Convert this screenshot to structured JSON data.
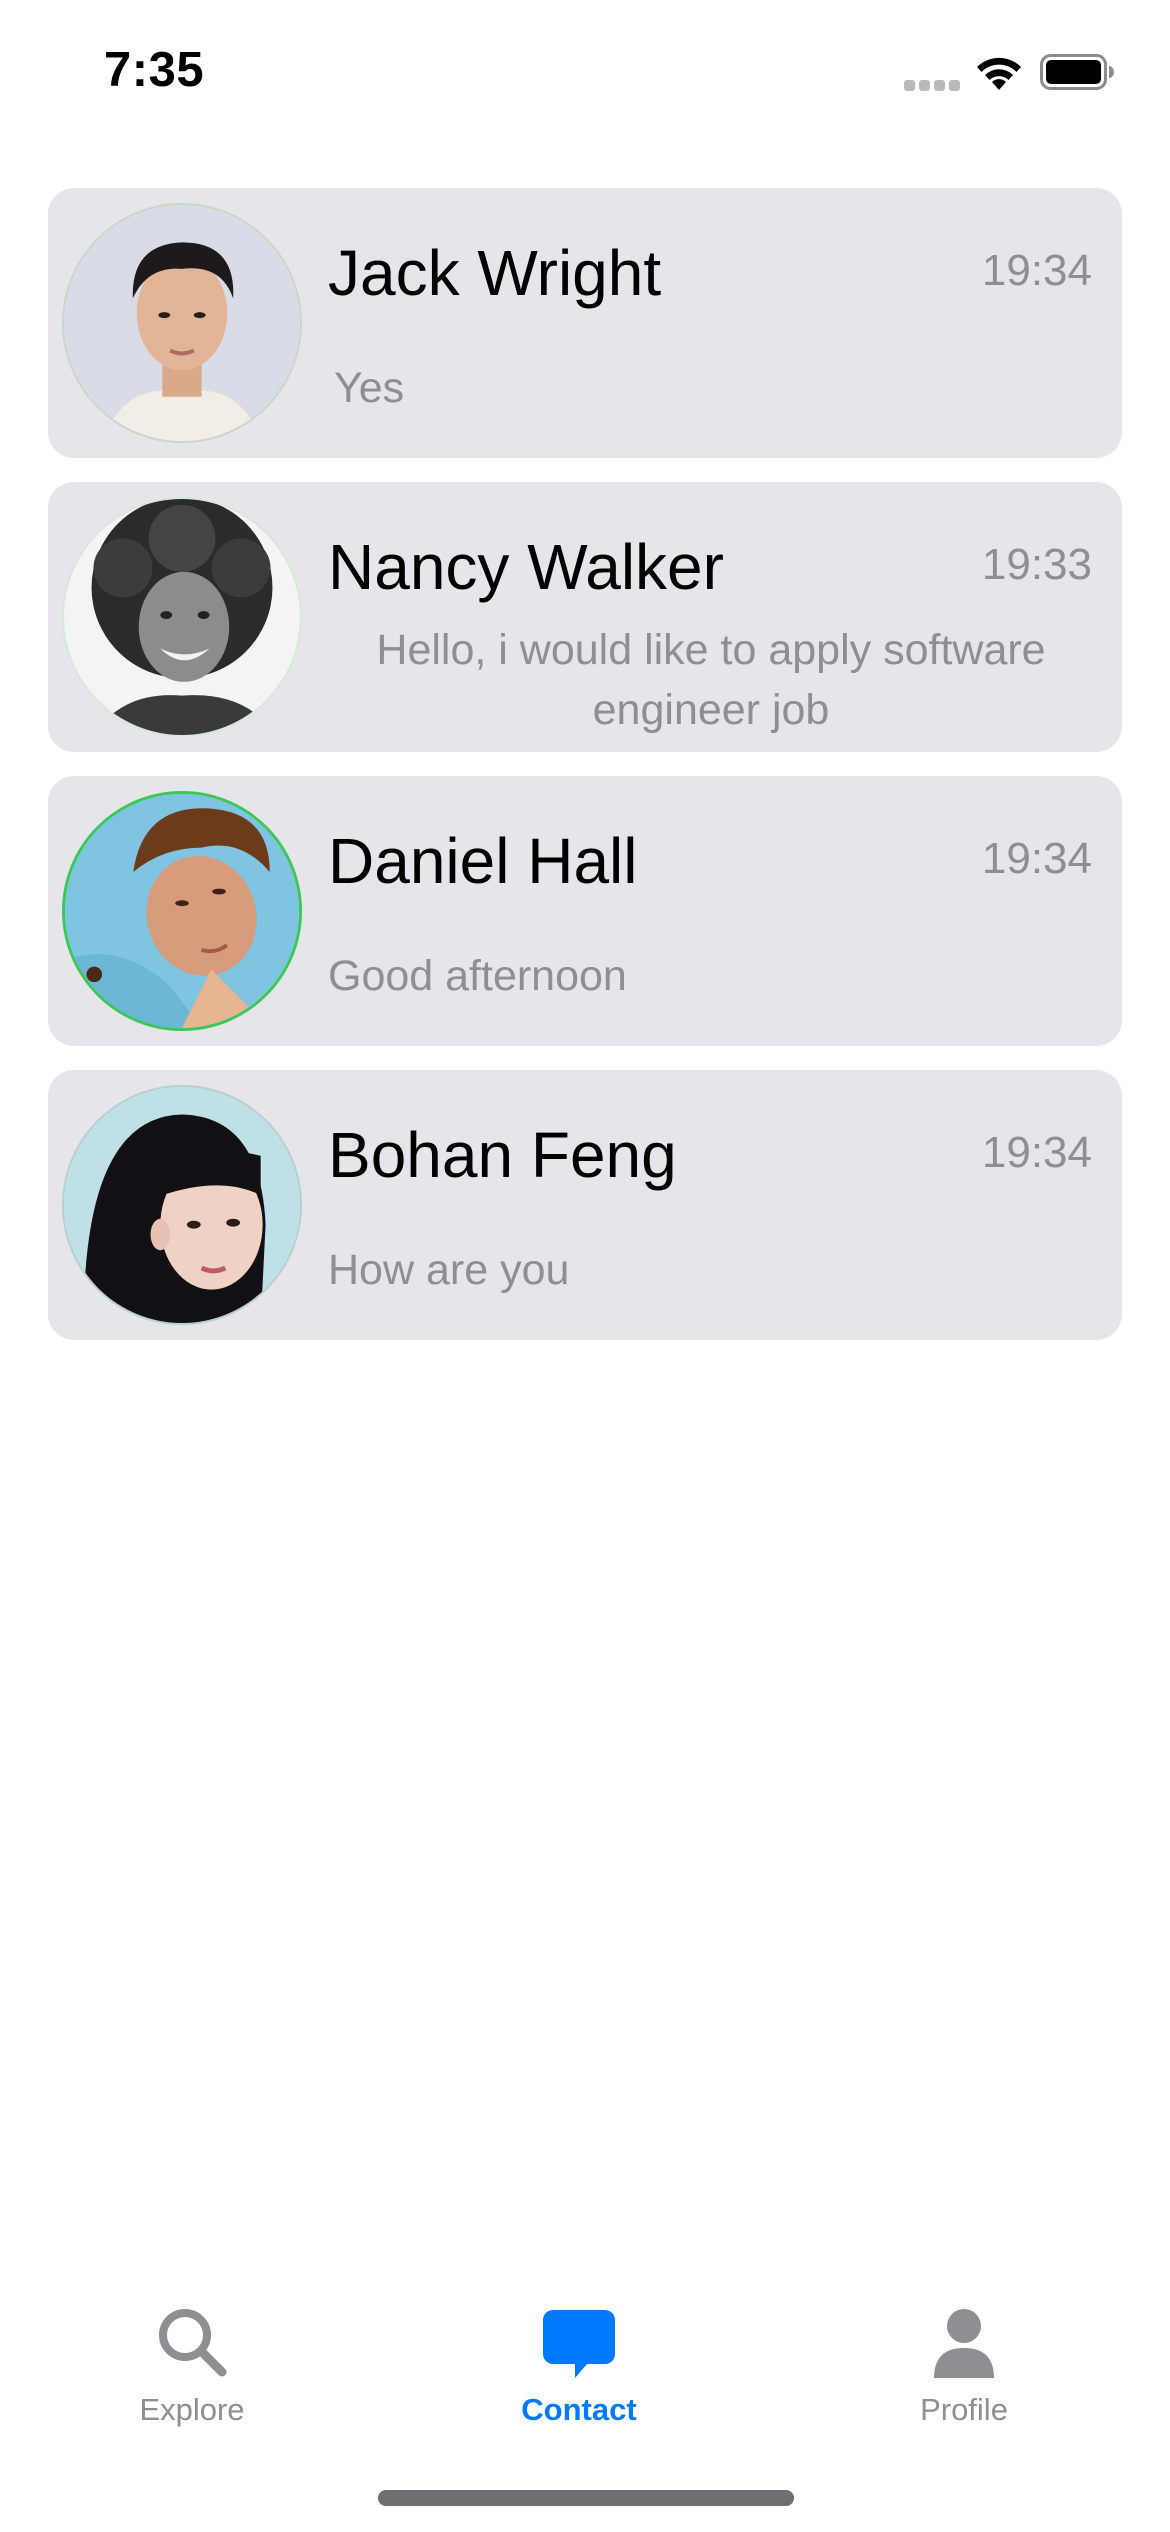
{
  "status_bar": {
    "time": "7:35"
  },
  "contacts": [
    {
      "name": "Jack Wright",
      "time": "19:34",
      "message": "Yes",
      "avatar_icon": "person-photo"
    },
    {
      "name": "Nancy Walker",
      "time": "19:33",
      "message": "Hello, i would like to apply software engineer job",
      "avatar_icon": "person-photo"
    },
    {
      "name": "Daniel Hall",
      "time": "19:34",
      "message": "Good afternoon",
      "avatar_icon": "person-photo"
    },
    {
      "name": "Bohan Feng",
      "time": "19:34",
      "message": "How are you",
      "avatar_icon": "person-photo"
    }
  ],
  "tab_bar": {
    "tabs": [
      {
        "label": "Explore",
        "icon": "magnifying-glass-icon",
        "active": false
      },
      {
        "label": "Contact",
        "icon": "chat-bubble-icon",
        "active": true
      },
      {
        "label": "Profile",
        "icon": "person-icon",
        "active": false
      }
    ]
  },
  "colors": {
    "accent": "#007aff",
    "card_background": "#e5e5ea",
    "secondary_text": "#8e8e93",
    "inactive_tab": "#8e8e93"
  }
}
